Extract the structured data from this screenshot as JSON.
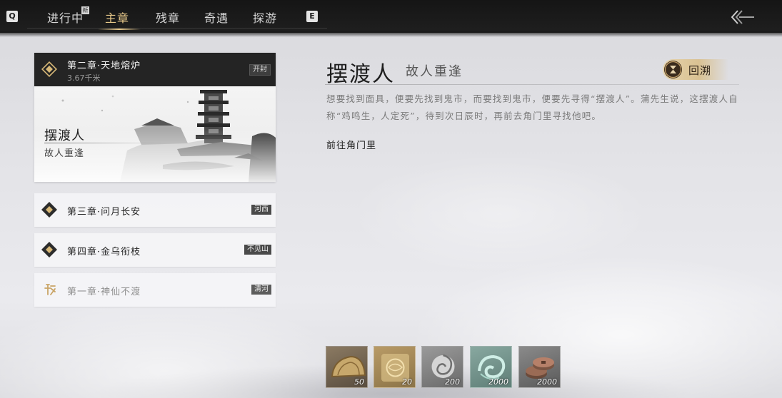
{
  "topbar": {
    "left_key": "Q",
    "right_key": "E",
    "new_badge": "新",
    "tabs": [
      {
        "label": "进行中"
      },
      {
        "label": "主章"
      },
      {
        "label": "残章"
      },
      {
        "label": "奇遇"
      },
      {
        "label": "探游"
      }
    ],
    "active_tab": "主章"
  },
  "chapters": {
    "current": {
      "title": "第二章·天地熔炉",
      "distance": "3.67千米",
      "region": "开封",
      "quest_title": "摆渡人",
      "quest_subtitle": "故人重逢"
    },
    "others": [
      {
        "title": "第三章·问月长安",
        "region": "河西"
      },
      {
        "title": "第四章·金乌衔枝",
        "region": "不见山"
      },
      {
        "title": "第一章·神仙不渡",
        "region": "清河"
      }
    ]
  },
  "detail": {
    "title": "摆渡人",
    "subtitle": "故人重逢",
    "review_label": "回溯",
    "description": "想要找到面具，便要先找到鬼市，而要找到鬼市，便要先寻得“摆渡人”。蒲先生说，这摆渡人自称“鸡鸣生，人定死”，待到次日辰时，再前去角门里寻找他吧。",
    "objective": "前往角门里"
  },
  "rewards": [
    {
      "icon": "bronze-coin-half-icon",
      "quantity": "50"
    },
    {
      "icon": "golden-token-icon",
      "quantity": "20"
    },
    {
      "icon": "wind-swirl-icon",
      "quantity": "200"
    },
    {
      "icon": "jade-swirl-icon",
      "quantity": "2000"
    },
    {
      "icon": "copper-coins-icon",
      "quantity": "2000"
    }
  ],
  "colors": {
    "accent": "#e8c98a",
    "topbar": "#1a1a1a",
    "review_button": "#dcc597"
  }
}
